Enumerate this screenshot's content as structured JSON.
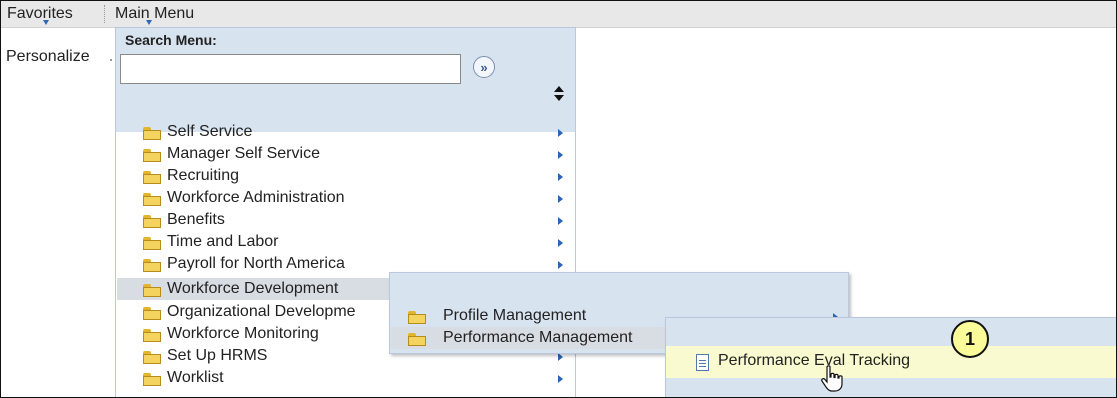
{
  "topbar": {
    "favorites": "Favorites",
    "main_menu": "Main Menu"
  },
  "personalize": "Personalize",
  "search": {
    "label": "Search Menu:",
    "value": "",
    "go_glyph": "»"
  },
  "menu_items": [
    {
      "label": "Self Service",
      "icon": "folder-icon"
    },
    {
      "label": "Manager Self Service",
      "icon": "folder-icon"
    },
    {
      "label": "Recruiting",
      "icon": "folder-icon"
    },
    {
      "label": "Workforce Administration",
      "icon": "folder-icon"
    },
    {
      "label": "Benefits",
      "icon": "folder-icon"
    },
    {
      "label": "Time and Labor",
      "icon": "folder-icon"
    },
    {
      "label": "Payroll for North America",
      "icon": "folder-icon"
    },
    {
      "label": "Workforce Development",
      "icon": "folder-icon",
      "selected": true
    },
    {
      "label": "Organizational Developme",
      "icon": "folder-icon"
    },
    {
      "label": "Workforce Monitoring",
      "icon": "folder-icon"
    },
    {
      "label": "Set Up HRMS",
      "icon": "folder-icon"
    },
    {
      "label": "Worklist",
      "icon": "folder-icon"
    }
  ],
  "submenu_workforce_development": [
    {
      "label": "Profile Management",
      "icon": "folder-icon"
    },
    {
      "label": "Performance Management",
      "icon": "folder-icon",
      "selected": true
    }
  ],
  "submenu_performance_management": [
    {
      "label": "Performance Eval Tracking",
      "icon": "document-icon",
      "hovered": true
    }
  ],
  "callout": "1",
  "colors": {
    "menu_bg": "#d8e3f0",
    "hover_bg": "#fafad0",
    "callout_bg": "#fbfb9a",
    "arrow": "#2c64b5"
  }
}
